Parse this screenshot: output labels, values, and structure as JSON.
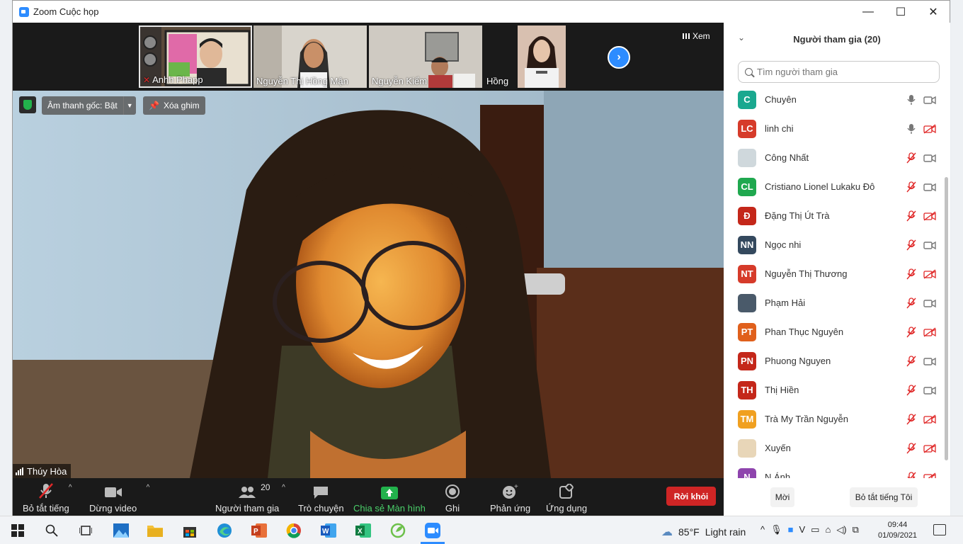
{
  "window": {
    "title": "Zoom Cuộc họp",
    "minimize": "—",
    "maximize": "☐",
    "close": "✕"
  },
  "strip": {
    "thumbnails": [
      {
        "name": "Anhh Phapp",
        "muted": true
      },
      {
        "name": "Nguyễn Thị Hồng Mận",
        "muted": false
      },
      {
        "name": "Nguyễn Kiểm",
        "muted": false
      },
      {
        "name": "Hồng",
        "muted": false
      }
    ],
    "view_label": "Xem"
  },
  "main": {
    "original_audio": "Âm thanh gốc: Bật",
    "unpin": "Xóa ghim",
    "speaker": "Thúy Hòa"
  },
  "toolbar": {
    "mute": "Bỏ tắt tiếng",
    "stop_video": "Dừng video",
    "participants": "Người tham gia",
    "participants_count": "20",
    "chat": "Trò chuyện",
    "share": "Chia sẻ Màn hình",
    "record": "Ghi",
    "reactions": "Phản ứng",
    "apps": "Ứng dụng",
    "leave": "Rời khỏi"
  },
  "panel": {
    "title": "Người tham gia (20)",
    "search_placeholder": "Tìm người tham gia",
    "participants": [
      {
        "initials": "C",
        "name": "Chuyên",
        "color": "#1aa88f",
        "mic": "on",
        "cam": "on"
      },
      {
        "initials": "LC",
        "name": "linh chi",
        "color": "#d63b2a",
        "mic": "on",
        "cam": "off"
      },
      {
        "initials": "",
        "name": "Công Nhất",
        "color": "#cfd8dc",
        "mic": "off",
        "cam": "on"
      },
      {
        "initials": "CL",
        "name": "Cristiano Lionel Lukaku Đô",
        "color": "#1fa84f",
        "mic": "off",
        "cam": "on"
      },
      {
        "initials": "Đ",
        "name": "Đặng Thị Út Trà",
        "color": "#c4271a",
        "mic": "off",
        "cam": "off"
      },
      {
        "initials": "NN",
        "name": "Ngọc nhi",
        "color": "#34495e",
        "mic": "off",
        "cam": "on"
      },
      {
        "initials": "NT",
        "name": "Nguyễn Thị Thương",
        "color": "#d63b2a",
        "mic": "off",
        "cam": "off"
      },
      {
        "initials": "",
        "name": "Phạm Hải",
        "color": "#4a5a6a",
        "mic": "off",
        "cam": "on"
      },
      {
        "initials": "PT",
        "name": "Phan Thục Nguyên",
        "color": "#e0601c",
        "mic": "off",
        "cam": "off"
      },
      {
        "initials": "PN",
        "name": "Phuong Nguyen",
        "color": "#c4271a",
        "mic": "off",
        "cam": "on"
      },
      {
        "initials": "TH",
        "name": "Thị Hiền",
        "color": "#c4271a",
        "mic": "off",
        "cam": "on"
      },
      {
        "initials": "TM",
        "name": "Trà My Trần Nguyễn",
        "color": "#f0a020",
        "mic": "off",
        "cam": "off"
      },
      {
        "initials": "",
        "name": "Xuyến",
        "color": "#e8d6b8",
        "mic": "off",
        "cam": "off"
      },
      {
        "initials": "N",
        "name": "N Ánh",
        "color": "#8e44ad",
        "mic": "off",
        "cam": "off"
      }
    ],
    "invite": "Mời",
    "unmute_me": "Bỏ tắt tiếng Tôi"
  },
  "taskbar": {
    "temperature": "85°F",
    "weather": "Light rain",
    "time": "09:44",
    "date": "01/09/2021"
  }
}
